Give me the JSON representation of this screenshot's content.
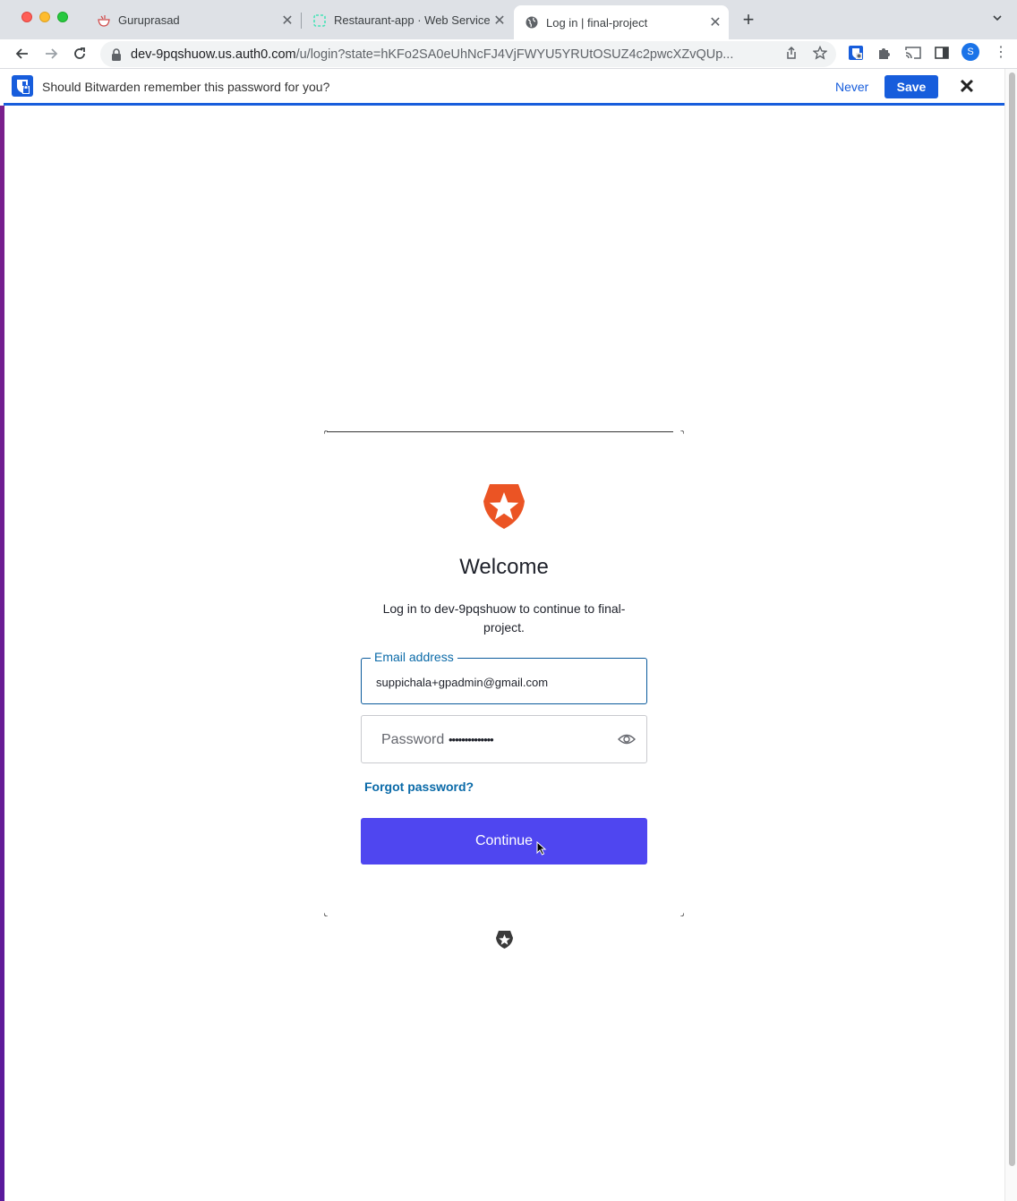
{
  "browser": {
    "tabs": [
      {
        "title": "Guruprasad",
        "favicon": "bowl-icon"
      },
      {
        "title": "Restaurant-app · Web Service",
        "favicon": "render-icon"
      },
      {
        "title": "Log in | final-project",
        "favicon": "globe-icon",
        "active": true
      }
    ],
    "url_host": "dev-9pqshuow.us.auth0.com",
    "url_path": "/u/login?state=hKFo2SA0eUhNcFJ4VjFWYU5YRUtOSUZ4c2pwcXZvQUp...",
    "profile_initial": "S"
  },
  "bitwarden": {
    "prompt": "Should Bitwarden remember this password for you?",
    "never_label": "Never",
    "save_label": "Save",
    "accent": "#175ddc"
  },
  "login": {
    "welcome": "Welcome",
    "subtitle": "Log in to dev-9pqshuow to continue to final-project.",
    "email_label": "Email address",
    "email_value": "suppichala+gpadmin@gmail.com",
    "password_label": "Password",
    "password_mask": "••••••••••••••",
    "forgot_label": "Forgot password?",
    "continue_label": "Continue",
    "button_color": "#4f46f0",
    "logo_color": "#eb5424"
  }
}
